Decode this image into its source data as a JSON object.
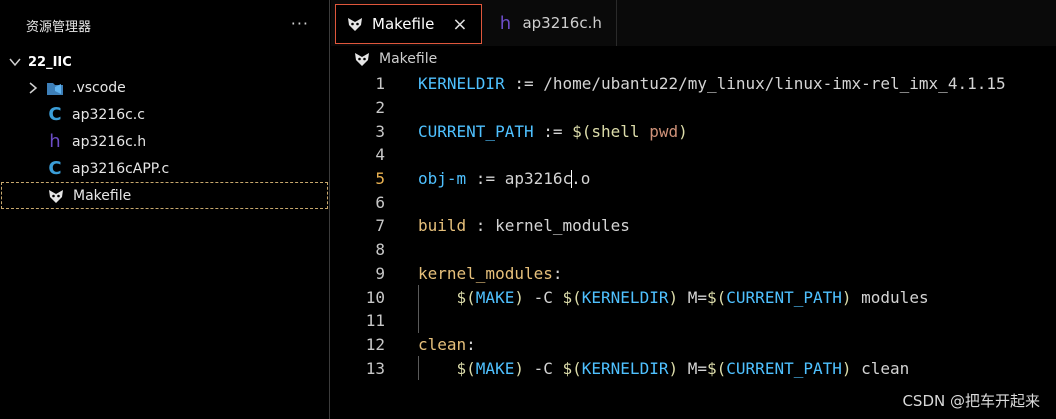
{
  "explorer": {
    "title": "资源管理器",
    "more": "···",
    "folder": "22_IIC",
    "items": [
      {
        "label": ".vscode",
        "icon": "vscode-folder-icon"
      },
      {
        "label": "ap3216c.c",
        "icon": "c-file-icon"
      },
      {
        "label": "ap3216c.h",
        "icon": "h-file-icon"
      },
      {
        "label": "ap3216cAPP.c",
        "icon": "c-file-icon"
      },
      {
        "label": "Makefile",
        "icon": "makefile-icon"
      }
    ]
  },
  "tabs": [
    {
      "label": "Makefile",
      "icon": "makefile-icon",
      "active": true,
      "close": "×"
    },
    {
      "label": "ap3216c.h",
      "icon": "h-file-icon",
      "active": false
    }
  ],
  "breadcrumb": "Makefile",
  "lines": [
    {
      "n": "1",
      "text": "KERNELDIR := /home/ubantu22/my_linux/linux-imx-rel_imx_4.1.15"
    },
    {
      "n": "2",
      "text": ""
    },
    {
      "n": "3",
      "text": "CURRENT_PATH := $(shell pwd)"
    },
    {
      "n": "4",
      "text": ""
    },
    {
      "n": "5",
      "text": "obj-m := ap3216c.o"
    },
    {
      "n": "6",
      "text": ""
    },
    {
      "n": "7",
      "text": "build : kernel_modules"
    },
    {
      "n": "8",
      "text": ""
    },
    {
      "n": "9",
      "text": "kernel_modules:"
    },
    {
      "n": "10",
      "text": "    $(MAKE) -C $(KERNELDIR) M=$(CURRENT_PATH) modules"
    },
    {
      "n": "11",
      "text": ""
    },
    {
      "n": "12",
      "text": "clean:"
    },
    {
      "n": "13",
      "text": "    $(MAKE) -C $(KERNELDIR) M=$(CURRENT_PATH) clean"
    }
  ],
  "current_line": "5",
  "watermark": "CSDN @把车开起来",
  "colors": {
    "accent": "#e0573c",
    "variable": "#4fc1ff",
    "function": "#dcdcaa",
    "string": "#ce9178",
    "target": "#d7ba7d"
  }
}
